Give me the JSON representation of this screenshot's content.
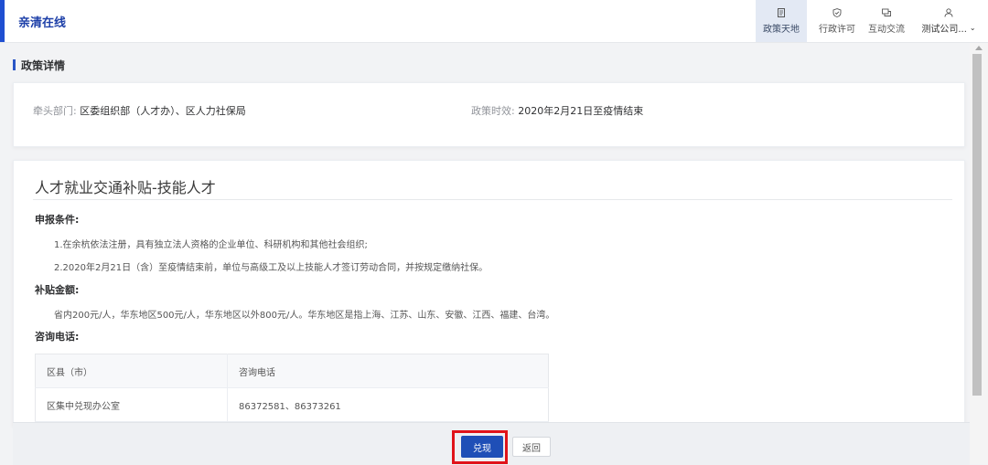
{
  "header": {
    "brand": "亲清在线",
    "nav": [
      {
        "label": "政策天地",
        "icon": "document-icon",
        "active": true
      },
      {
        "label": "行政许可",
        "icon": "shield-check-icon",
        "active": false
      },
      {
        "label": "互动交流",
        "icon": "chat-icon",
        "active": false
      }
    ],
    "user": {
      "label": "测试公司...",
      "icon": "user-icon"
    }
  },
  "page": {
    "title": "政策详情"
  },
  "info": {
    "lead_label": "牵头部门:",
    "lead_value": "区委组织部（人才办）、区人力社保局",
    "period_label": "政策时效:",
    "period_value": "2020年2月21日至疫情结束"
  },
  "policy": {
    "name": "人才就业交通补贴-技能人才",
    "conditions_title": "申报条件:",
    "conditions": [
      "1.在余杭依法注册，具有独立法人资格的企业单位、科研机构和其他社会组织;",
      "2.2020年2月21日（含）至疫情结束前，单位与高级工及以上技能人才签订劳动合同，并按规定缴纳社保。"
    ],
    "amount_title": "补贴金额:",
    "amount_text": "省内200元/人，华东地区500元/人，华东地区以外800元/人。华东地区是指上海、江苏、山东、安徽、江西、福建、台湾。",
    "phone_title": "咨询电话:",
    "table": {
      "headers": [
        "区县（市）",
        "咨询电话"
      ],
      "rows": [
        [
          "区集中兑现办公室",
          "86372581、86373261"
        ]
      ]
    }
  },
  "actions": {
    "redeem": "兑现",
    "back": "返回"
  },
  "colors": {
    "accent": "#1f4fb7",
    "brand": "#1d3fa8",
    "highlight": "#e0131a"
  }
}
